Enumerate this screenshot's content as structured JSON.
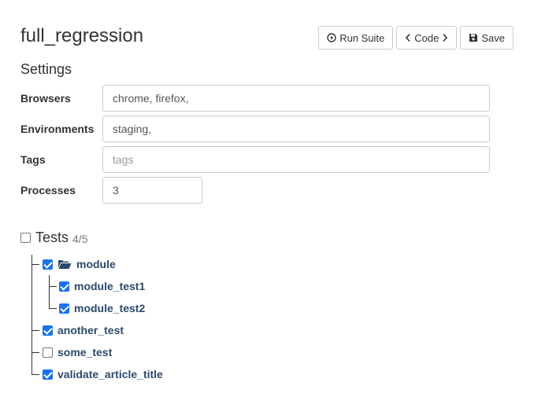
{
  "suite": {
    "title": "full_regression"
  },
  "toolbar": {
    "run_label": "Run Suite",
    "code_label": "Code",
    "save_label": "Save"
  },
  "settings": {
    "title": "Settings",
    "browsers": {
      "label": "Browsers",
      "value": "chrome, firefox,"
    },
    "environments": {
      "label": "Environments",
      "value": "staging,"
    },
    "tags": {
      "label": "Tags",
      "value": "",
      "placeholder": "tags"
    },
    "processes": {
      "label": "Processes",
      "value": "3"
    }
  },
  "tests": {
    "label": "Tests",
    "count": "4/5",
    "all_checked": false,
    "tree": [
      {
        "name": "module",
        "type": "folder",
        "checked": true,
        "children": [
          {
            "name": "module_test1",
            "checked": true
          },
          {
            "name": "module_test2",
            "checked": true
          }
        ]
      },
      {
        "name": "another_test",
        "checked": true
      },
      {
        "name": "some_test",
        "checked": false
      },
      {
        "name": "validate_article_title",
        "checked": true
      }
    ]
  }
}
